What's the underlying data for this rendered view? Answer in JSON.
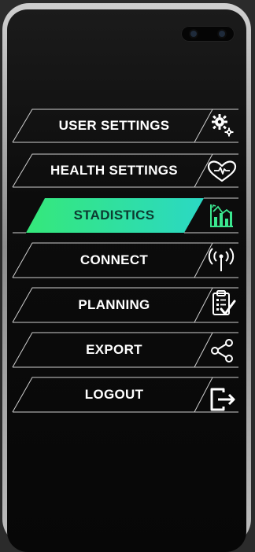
{
  "colors": {
    "active_gradient_start": "#35e87a",
    "active_gradient_end": "#2bd8c4",
    "active_text": "#0c3b31",
    "text": "#ffffff",
    "line": "#cfcfcf"
  },
  "menu": {
    "items": [
      {
        "label": "USER SETTINGS",
        "icon": "gears-icon",
        "active": false
      },
      {
        "label": "HEALTH SETTINGS",
        "icon": "heart-pulse-icon",
        "active": false
      },
      {
        "label": "STADISTICS",
        "icon": "statistics-chart-icon",
        "active": true
      },
      {
        "label": "CONNECT",
        "icon": "antenna-signal-icon",
        "active": false
      },
      {
        "label": "PLANNING",
        "icon": "clipboard-checklist-icon",
        "active": false
      },
      {
        "label": "EXPORT",
        "icon": "share-icon",
        "active": false
      },
      {
        "label": "LOGOUT",
        "icon": "logout-icon",
        "active": false
      }
    ]
  }
}
